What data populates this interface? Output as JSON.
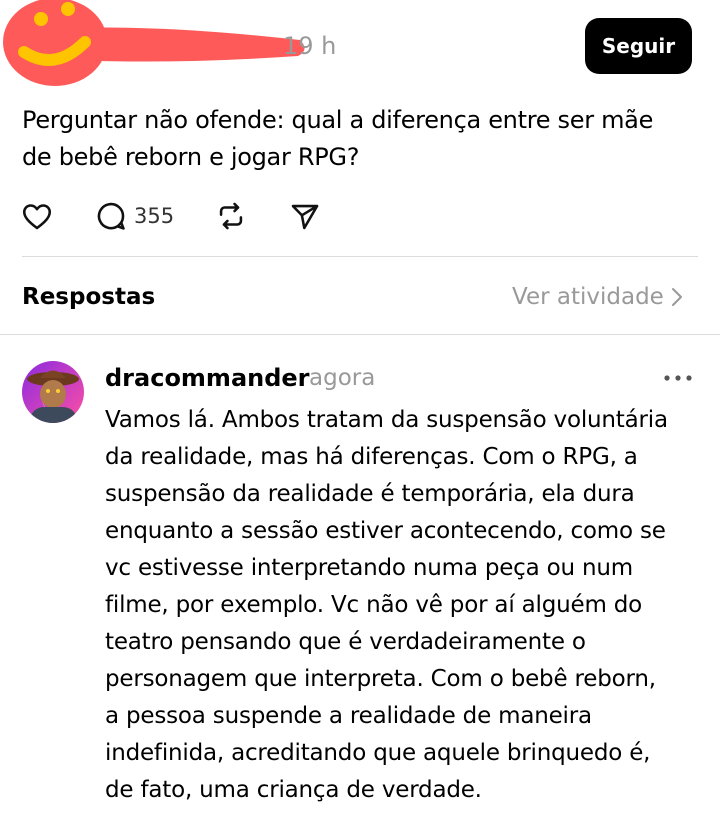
{
  "post": {
    "timestamp": "19 h",
    "follow_label": "Seguir",
    "text": "Perguntar não ofende: qual a diferença entre ser mãe de bebê reborn e jogar RPG?",
    "reply_count": "355"
  },
  "icons": {
    "like": "heart-icon",
    "reply": "comment-bubble-icon",
    "repost": "repost-icon",
    "share": "send-icon",
    "more": "more-dots-icon",
    "chevron": "chevron-right-icon"
  },
  "replies": {
    "title": "Respostas",
    "activity_label": "Ver atividade"
  },
  "comment": {
    "username": "dracommander",
    "time": "agora",
    "text": "Vamos lá. Ambos tratam da suspensão voluntária\nda realidade, mas há diferenças. Com o RPG, a\nsuspensão da realidade é temporária, ela dura\nenquanto a sessão estiver acontecendo, como se\nvc estivesse interpretando numa peça ou num\nfilme, por exemplo. Vc não vê por aí alguém do\nteatro pensando que é verdadeiramente  o\npersonagem que interpreta. Com o bebê reborn,\na pessoa suspende a realidade de maneira\nindefinida, acreditando que aquele brinquedo é,\nde fato, uma criança de verdade."
  },
  "colors": {
    "redaction": "#ff5a5a",
    "redaction_smile": "#ffc400",
    "follow_bg": "#000000",
    "muted_text": "#999999",
    "divider": "#dddddd"
  }
}
